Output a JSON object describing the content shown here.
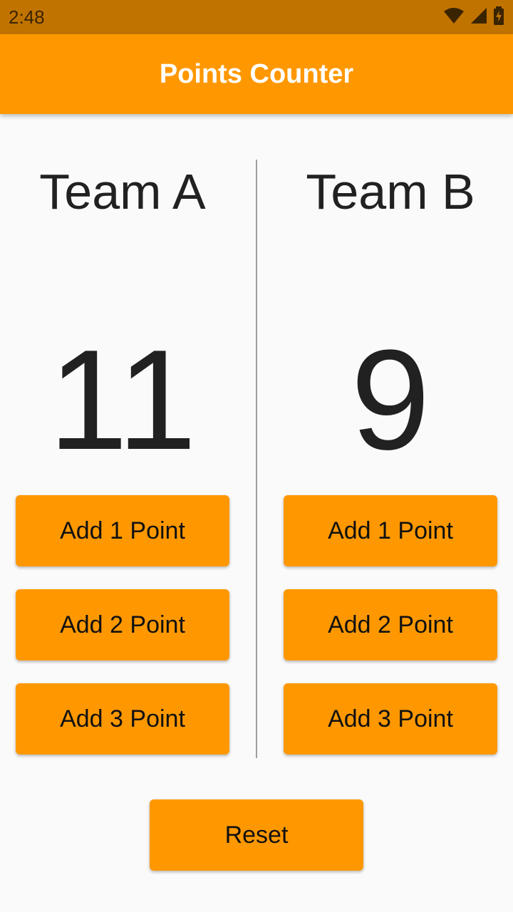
{
  "status_bar": {
    "time": "2:48",
    "icons": [
      "wifi-icon",
      "cell-signal-icon",
      "battery-charging-icon"
    ]
  },
  "app_bar": {
    "title": "Points Counter"
  },
  "team_a": {
    "name": "Team A",
    "score": "11",
    "buttons": [
      "Add 1 Point",
      "Add 2 Point",
      "Add 3 Point"
    ]
  },
  "team_b": {
    "name": "Team B",
    "score": "9",
    "buttons": [
      "Add 1 Point",
      "Add 2 Point",
      "Add 3 Point"
    ]
  },
  "reset_label": "Reset",
  "colors": {
    "accent": "#ff9800",
    "status_bar": "#c17300",
    "background": "#fafafa",
    "text": "#212121"
  }
}
